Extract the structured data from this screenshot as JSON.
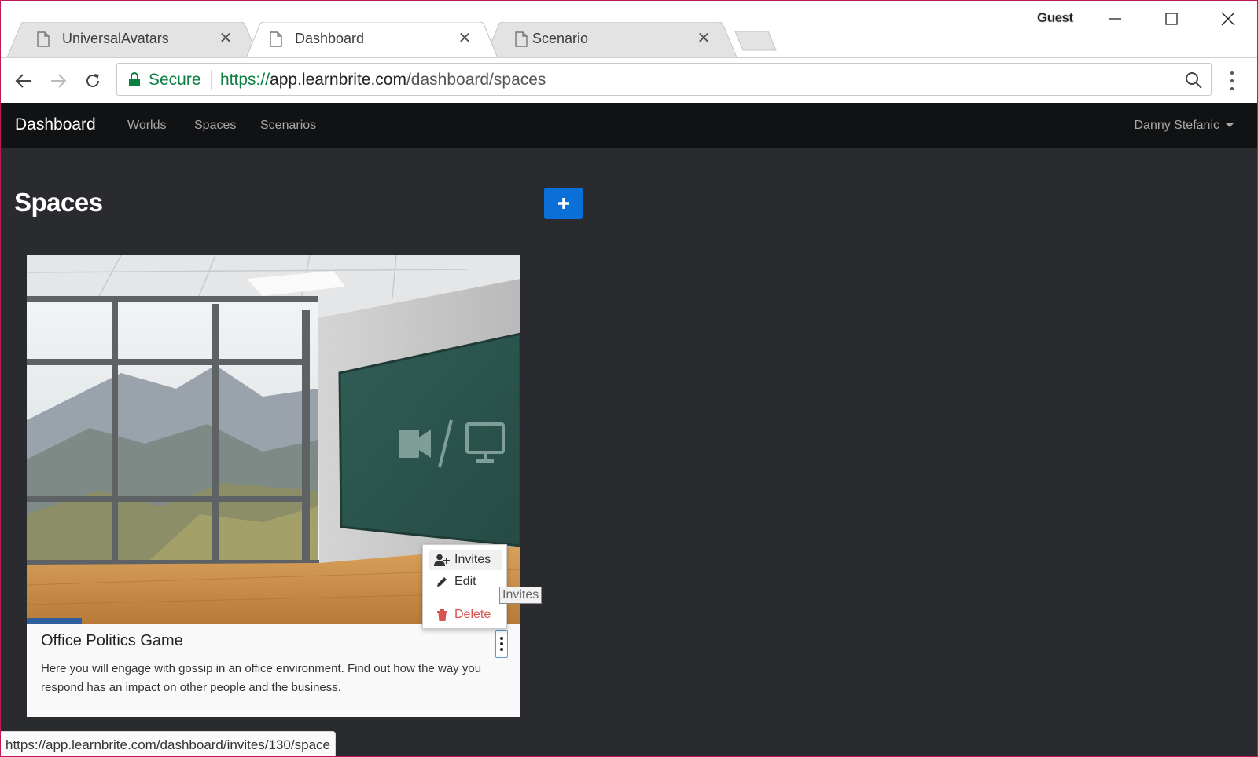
{
  "browser": {
    "tabs": [
      {
        "title": "UniversalAvatars",
        "active": false
      },
      {
        "title": "Dashboard",
        "active": true
      },
      {
        "title": "Scenario",
        "active": false
      }
    ],
    "profile_label": "Guest",
    "omnibox": {
      "secure_label": "Secure",
      "url_scheme": "https://",
      "url_host": "app.learnbrite.com",
      "url_path": "/dashboard/spaces"
    },
    "status_url": "https://app.learnbrite.com/dashboard/invites/130/space"
  },
  "navbar": {
    "brand": "Dashboard",
    "links": [
      "Worlds",
      "Spaces",
      "Scenarios"
    ],
    "user": "Danny Stefanic"
  },
  "page": {
    "title": "Spaces",
    "add_button_icon": "plus-icon"
  },
  "cards": [
    {
      "title": "Office Politics Game",
      "description": "Here you will engage with gossip in an office environment. Find out how the way you respond has an impact on other people and the business.",
      "menu": [
        {
          "label": "Invites",
          "icon": "user-plus-icon"
        },
        {
          "label": "Edit",
          "icon": "pencil-icon"
        },
        {
          "label": "Delete",
          "icon": "trash-icon"
        }
      ],
      "tooltip": "Invites"
    }
  ],
  "colors": {
    "accent": "#0a6fd8",
    "page_bg": "#2a2b2e",
    "navbar_bg": "#111214",
    "secure_green": "#0b8043",
    "danger": "#d9534f",
    "window_border": "#c2185b"
  }
}
